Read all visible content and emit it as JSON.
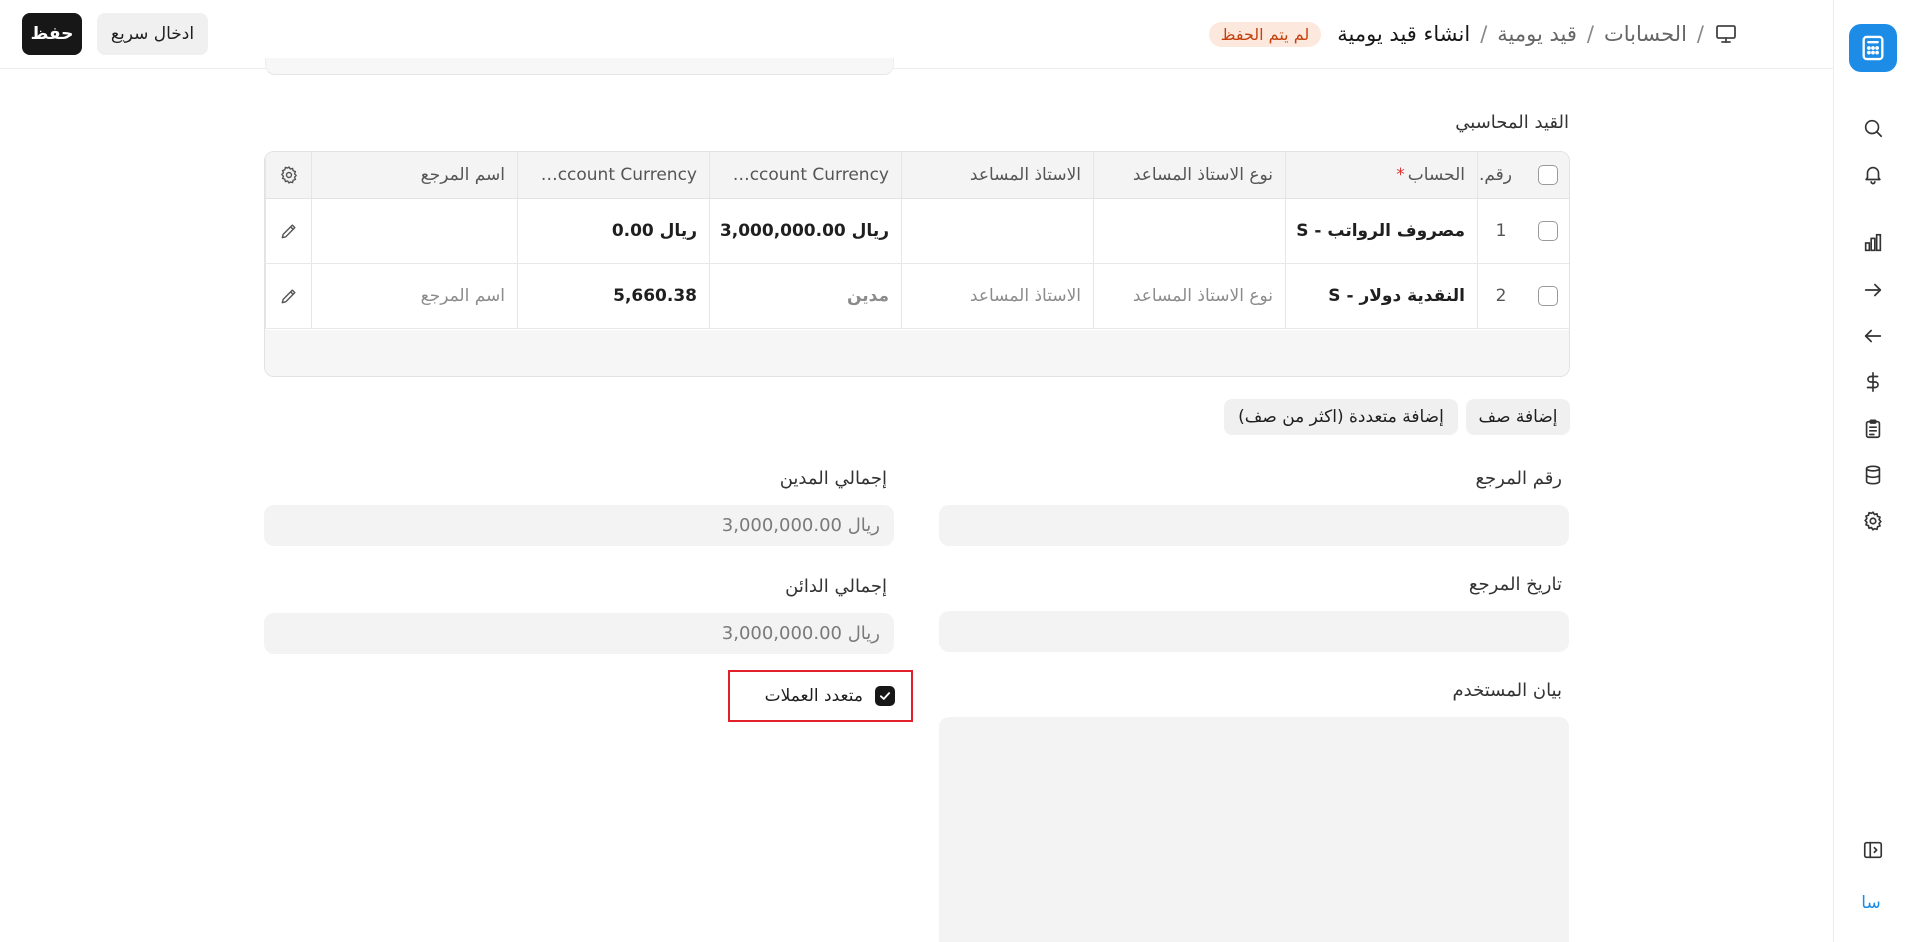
{
  "topbar": {
    "save_label": "حفظ",
    "quick_entry_label": "ادخال سريع",
    "breadcrumb": [
      "الحسابات",
      "قيد يومية",
      "انشاء قيد يومية"
    ],
    "status_badge": "لم يتم الحفظ"
  },
  "sidebar": {
    "logo": "calculator-icon",
    "icons": [
      "search-icon",
      "bell-icon",
      "bar-chart-icon",
      "arrow-right-icon",
      "arrow-left-icon",
      "dollar-icon",
      "clipboard-icon",
      "database-icon",
      "gear-icon"
    ],
    "collapse_icon": "sidebar-toggle-icon",
    "avatar_text": "سا"
  },
  "accounting_entry": {
    "section_title": "القيد المحاسبي",
    "columns": {
      "no": "رقم.",
      "account": "الحساب",
      "party_type": "نوع الاستاذ المساعد",
      "party": "الاستاذ المساعد",
      "debit": "…ccount Currency",
      "credit": "…ccount Currency",
      "reference_name": "اسم المرجع"
    },
    "rows": [
      {
        "no": "1",
        "account": "مصروف الرواتب - S",
        "party_type": "",
        "party": "",
        "debit": "ريال 3,000,000.00",
        "credit": "ريال 0.00",
        "reference_name": ""
      },
      {
        "no": "2",
        "account": "النقدية دولار - S",
        "party_type": "نوع الاستاذ المساعد",
        "party": "الاستاذ المساعد",
        "debit": "مدين",
        "credit": "5,660.38",
        "reference_name": "اسم المرجع"
      }
    ],
    "add_row_label": "إضافة صف",
    "add_multiple_label": "إضافة متعددة (اكثر من صف)"
  },
  "form": {
    "reference_number_label": "رقم المرجع",
    "reference_date_label": "تاريخ المرجع",
    "user_remark_label": "بيان المستخدم",
    "total_debit_label": "إجمالي المدين",
    "total_debit_value": "ريال 3,000,000.00",
    "total_credit_label": "إجمالي الدائن",
    "total_credit_value": "ريال 3,000,000.00",
    "multi_currency_label": "متعدد العملات",
    "multi_currency_checked": true
  }
}
